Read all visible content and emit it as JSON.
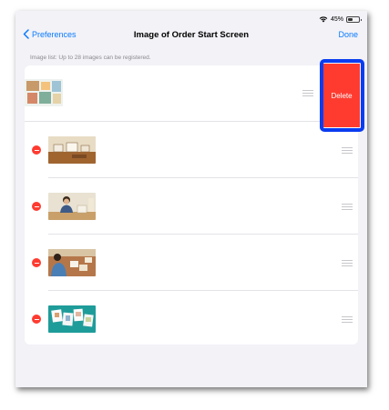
{
  "status_bar": {
    "battery_text": "45%",
    "battery_level": 0.45
  },
  "nav": {
    "back_label": "Preferences",
    "title": "Image of Order Start Screen",
    "done_label": "Done"
  },
  "section_header": "Image list: Up to 28 images can be registered.",
  "delete_action_label": "Delete",
  "rows": [
    {
      "thumbnail": "photo-collage-thumbnail",
      "swiped": true
    },
    {
      "thumbnail": "wooden-table-photos-thumbnail",
      "swiped": false
    },
    {
      "thumbnail": "person-sitting-thumbnail",
      "swiped": false
    },
    {
      "thumbnail": "person-with-photos-thumbnail",
      "swiped": false
    },
    {
      "thumbnail": "photo-prints-teal-thumbnail",
      "swiped": false
    }
  ],
  "colors": {
    "accent": "#0a7aff",
    "destructive": "#ff3b30",
    "highlight": "#0a3cf0",
    "background": "#f2f2f7"
  }
}
